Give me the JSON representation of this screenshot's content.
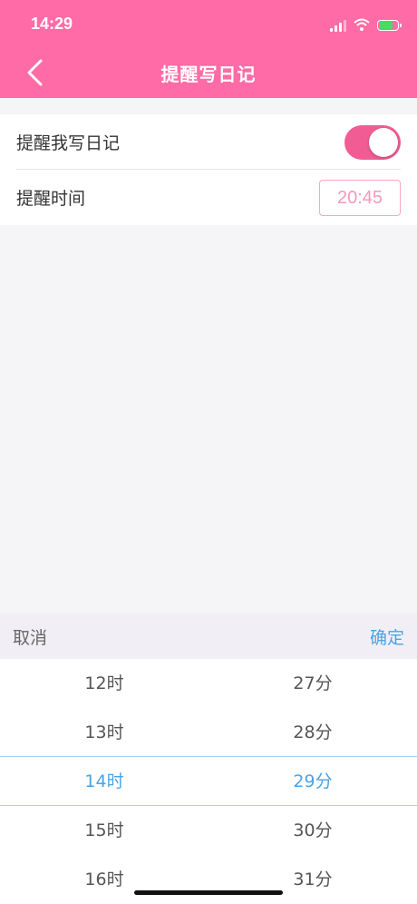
{
  "status_bar": {
    "time": "14:29"
  },
  "header": {
    "title": "提醒写日记"
  },
  "settings": {
    "remind_label": "提醒我写日记",
    "remind_enabled": true,
    "time_label": "提醒时间",
    "time_value": "20:45"
  },
  "picker": {
    "cancel_label": "取消",
    "confirm_label": "确定",
    "hours": [
      "12时",
      "13时",
      "14时",
      "15时",
      "16时"
    ],
    "minutes": [
      "27分",
      "28分",
      "29分",
      "30分",
      "31分"
    ],
    "selected_index": 2
  },
  "colors": {
    "header": "#ff6ba6",
    "toggle_on": "#f25c95",
    "accent_blue": "#4aa3e6"
  }
}
